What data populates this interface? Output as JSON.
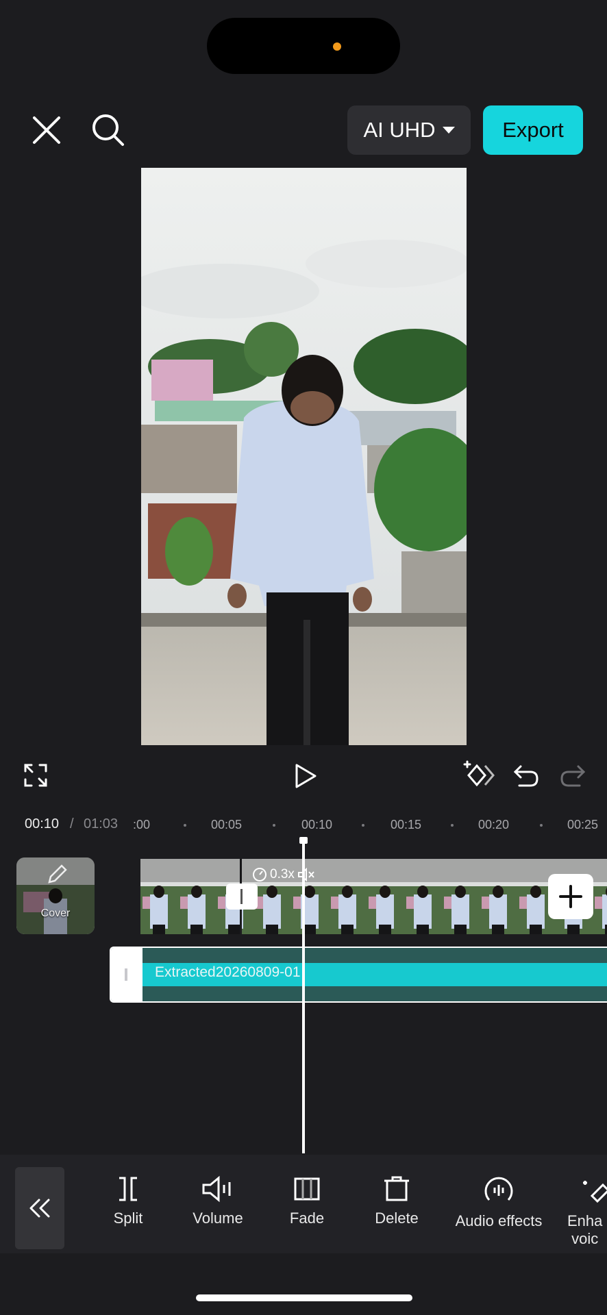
{
  "header": {
    "close_icon": "close-icon",
    "search_icon": "search-icon",
    "quality_label": "AI UHD",
    "export_label": "Export"
  },
  "colors": {
    "accent": "#16d5dd",
    "background": "#1c1c1f",
    "audio_track": "#2b5a57"
  },
  "controls": {
    "fullscreen_icon": "fullscreen-icon",
    "play_icon": "play-icon",
    "keyframe_icon": "keyframe-icon",
    "undo_icon": "undo-icon",
    "redo_icon": "redo-icon"
  },
  "timeline": {
    "current_time": "00:10",
    "separator": "/",
    "total_time": "01:03",
    "ticks": [
      ":00",
      "00:05",
      "00:10",
      "00:15",
      "00:20",
      "00:25"
    ],
    "cover_label": "Cover",
    "speed_label": "0.3x",
    "audio_clip_name": "Extracted20260809-01"
  },
  "toolbar": {
    "back_icon": "double-chevron-left-icon",
    "items": [
      {
        "label": "Split",
        "icon": "split-icon"
      },
      {
        "label": "Volume",
        "icon": "volume-icon"
      },
      {
        "label": "Fade",
        "icon": "fade-icon"
      },
      {
        "label": "Delete",
        "icon": "delete-icon"
      },
      {
        "label": "Audio effects",
        "icon": "audio-effects-icon"
      },
      {
        "label": "Enha voic",
        "icon": "enhance-voice-icon"
      }
    ]
  }
}
